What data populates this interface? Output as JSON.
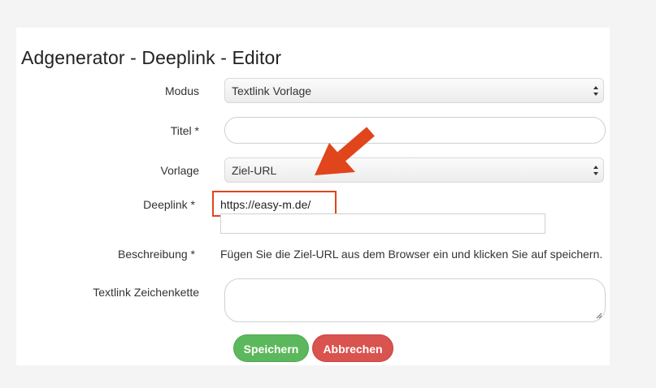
{
  "page": {
    "title": "Adgenerator - Deeplink - Editor"
  },
  "form": {
    "modus": {
      "label": "Modus",
      "value": "Textlink Vorlage"
    },
    "titel": {
      "label": "Titel *",
      "value": ""
    },
    "vorlage": {
      "label": "Vorlage",
      "value": "Ziel-URL"
    },
    "deeplink": {
      "label": "Deeplink *",
      "value": "https://easy-m.de/"
    },
    "beschreibung": {
      "label": "Beschreibung *",
      "text": "Fügen Sie die Ziel-URL aus dem Browser ein und klicken Sie auf speichern."
    },
    "textlink": {
      "label": "Textlink Zeichenkette",
      "value": ""
    }
  },
  "buttons": {
    "save": "Speichern",
    "cancel": "Abbrechen"
  },
  "colors": {
    "annotation": "#e0451c",
    "save": "#5cb85c",
    "cancel": "#d9534f"
  },
  "icons": {
    "select_arrows": "up-down-chevron-icon",
    "annotation_arrow": "arrow-icon"
  }
}
